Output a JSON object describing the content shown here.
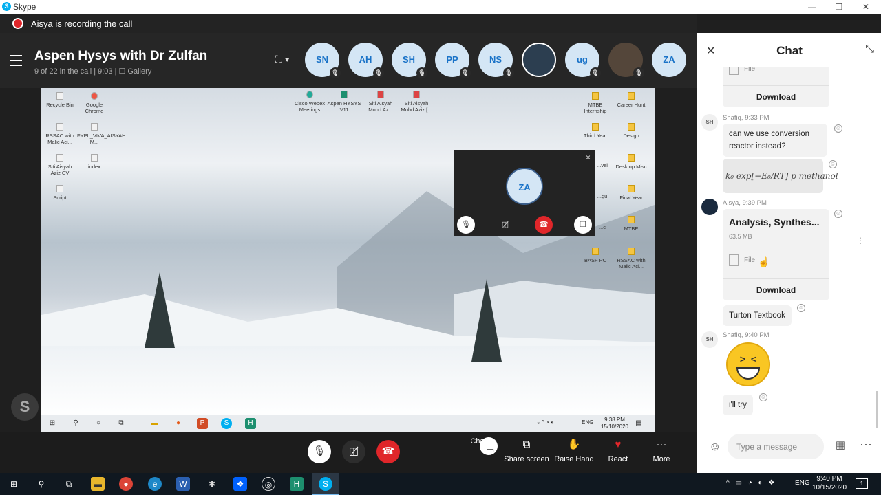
{
  "window": {
    "title": "Skype",
    "minimize": "—",
    "maximize": "❐",
    "close": "✕"
  },
  "recording": {
    "text": "Aisya is recording the call"
  },
  "call": {
    "title": "Aspen Hysys with Dr Zulfan",
    "subtitle": "9 of 22 in the call | 9:03 | ☐ Gallery",
    "participants": [
      "SN",
      "AH",
      "SH",
      "PP",
      "NS",
      "",
      "ug",
      "",
      "ZA"
    ]
  },
  "shared_screen": {
    "desktop_icons": [
      "Recycle Bin",
      "Google Chrome",
      "RSSAC with Malic Aci...",
      "FYPII_VIVA_AISYAH M...",
      "Siti Aisyah Aziz CV",
      "index",
      "Script",
      "Cisco Webex Meetings",
      "Aspen HYSYS V11",
      "Siti Aisyah Mohd Az...",
      "Siti Aisyah Mohd Aziz [...",
      "MTBE Internship",
      "Career Hunt",
      "Third Year",
      "Design",
      "...vel",
      "Desktop Misc",
      "...gu",
      "Final Year",
      "...c",
      "MTBE",
      "BASF PC",
      "RSSAC with Malic Aci..."
    ],
    "pip": {
      "initials": "ZA",
      "close": "×"
    },
    "taskbar": {
      "time": "9:38 PM",
      "date": "15/10/2020",
      "lang": "ENG"
    }
  },
  "controls": {
    "chat": "Chat",
    "share": "Share screen",
    "raise": "Raise Hand",
    "react": "React",
    "more": "More"
  },
  "chat": {
    "title": "Chat",
    "top_file_label": "File",
    "top_download": "Download",
    "msg1": {
      "initials": "SH",
      "meta": "Shafiq, 9:33 PM",
      "text": "can we use conversion reactor instead?",
      "formula": "k₀ exp[−E₀/RT] p methanol"
    },
    "msg2": {
      "meta": "Aisya, 9:39 PM",
      "file_title": "Analysis, Synthes...",
      "file_size": "63.5 MB",
      "file_label": "File",
      "download": "Download",
      "text": "Turton Textbook"
    },
    "msg3": {
      "initials": "SH",
      "meta": "Shafiq, 9:40 PM",
      "text": "i'll try"
    },
    "compose_placeholder": "Type a message"
  },
  "taskbar": {
    "time": "9:40 PM",
    "date": "10/15/2020",
    "lang": "ENG",
    "notif": "1"
  },
  "colors": {
    "accent": "#00aff0",
    "end_call": "#e0262a",
    "avatar_bg": "#d4e6f5"
  }
}
